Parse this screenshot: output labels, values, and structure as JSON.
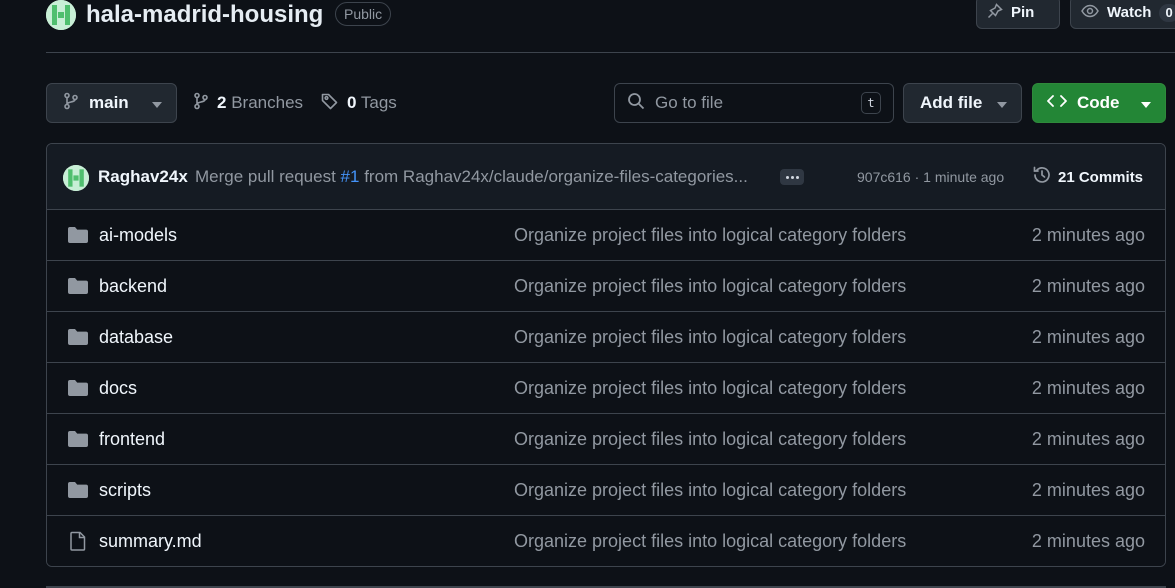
{
  "repo": {
    "name": "hala-madrid-housing",
    "visibility": "Public",
    "pin_label": "Pin",
    "watch_label": "Watch",
    "watch_count": "0"
  },
  "toolbar": {
    "branch": "main",
    "branches_count": "2",
    "branches_label": "Branches",
    "tags_count": "0",
    "tags_label": "Tags",
    "search_placeholder": "Go to file",
    "search_shortcut": "t",
    "add_file_label": "Add file",
    "code_label": "Code"
  },
  "latest_commit": {
    "author": "Raghav24x",
    "message_prefix": "Merge pull request",
    "pr_number": "#1",
    "message_suffix": "from Raghav24x/claude/organize-files-categories...",
    "sha": "907c616",
    "separator": "·",
    "time": "1 minute ago",
    "commits_label": "21 Commits"
  },
  "files": [
    {
      "name": "ai-models",
      "type": "folder",
      "commit": "Organize project files into logical category folders",
      "time": "2 minutes ago"
    },
    {
      "name": "backend",
      "type": "folder",
      "commit": "Organize project files into logical category folders",
      "time": "2 minutes ago"
    },
    {
      "name": "database",
      "type": "folder",
      "commit": "Organize project files into logical category folders",
      "time": "2 minutes ago"
    },
    {
      "name": "docs",
      "type": "folder",
      "commit": "Organize project files into logical category folders",
      "time": "2 minutes ago"
    },
    {
      "name": "frontend",
      "type": "folder",
      "commit": "Organize project files into logical category folders",
      "time": "2 minutes ago"
    },
    {
      "name": "scripts",
      "type": "folder",
      "commit": "Organize project files into logical category folders",
      "time": "2 minutes ago"
    },
    {
      "name": "summary.md",
      "type": "file",
      "commit": "Organize project files into logical category folders",
      "time": "2 minutes ago"
    }
  ],
  "colors": {
    "background": "#0d1117",
    "border": "#3d444d",
    "primary_button": "#238636",
    "link": "#4493f8",
    "muted_text": "#9198a1",
    "folder_icon": "#9198a1"
  }
}
